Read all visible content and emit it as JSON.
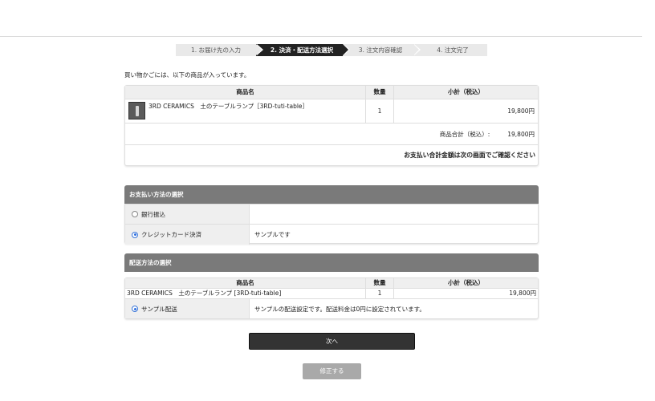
{
  "steps": [
    {
      "label": "1.  お届け先の入力",
      "active": false
    },
    {
      "label": "2.  決済・配送方法選択",
      "active": true
    },
    {
      "label": "3.  注文内容確認",
      "active": false
    },
    {
      "label": "4.  注文完了",
      "active": false
    }
  ],
  "intro": "買い物かごには、以下の商品が入っています。",
  "cart": {
    "headers": {
      "name": "商品名",
      "qty": "数量",
      "subtotal": "小計（税込）"
    },
    "rows": [
      {
        "name": "3RD CERAMICS　土のテーブルランプ［3RD-tuti-table］",
        "qty": "1",
        "subtotal": "19,800円"
      }
    ],
    "total_label": "商品合計（税込）:",
    "total_value": "19,800円",
    "note": "お支払い合計金額は次の画面でご確認ください"
  },
  "payment": {
    "heading": "お支払い方法の選択",
    "options": [
      {
        "label": "銀行振込",
        "desc": "",
        "selected": false
      },
      {
        "label": "クレジットカード決済",
        "desc": "サンプルです",
        "selected": true
      }
    ]
  },
  "shipping": {
    "heading": "配送方法の選択",
    "headers": {
      "name": "商品名",
      "qty": "数量",
      "subtotal": "小計（税込）"
    },
    "rows": [
      {
        "name": "3RD CERAMICS　土のテーブルランプ [3RD-tuti-table]",
        "qty": "1",
        "subtotal": "19,800円"
      }
    ],
    "method": {
      "label": "サンプル配送",
      "desc": "サンプルの配送設定です。配送料金は0円に設定されています。",
      "selected": true
    }
  },
  "buttons": {
    "next": "次へ",
    "fix": "修正する"
  },
  "colors": {
    "active_step": "#222222",
    "section_header": "#7a7a7a",
    "next_button": "#333333",
    "fix_button": "#a9a9a9",
    "radio_selected": "#2f6fe0"
  }
}
